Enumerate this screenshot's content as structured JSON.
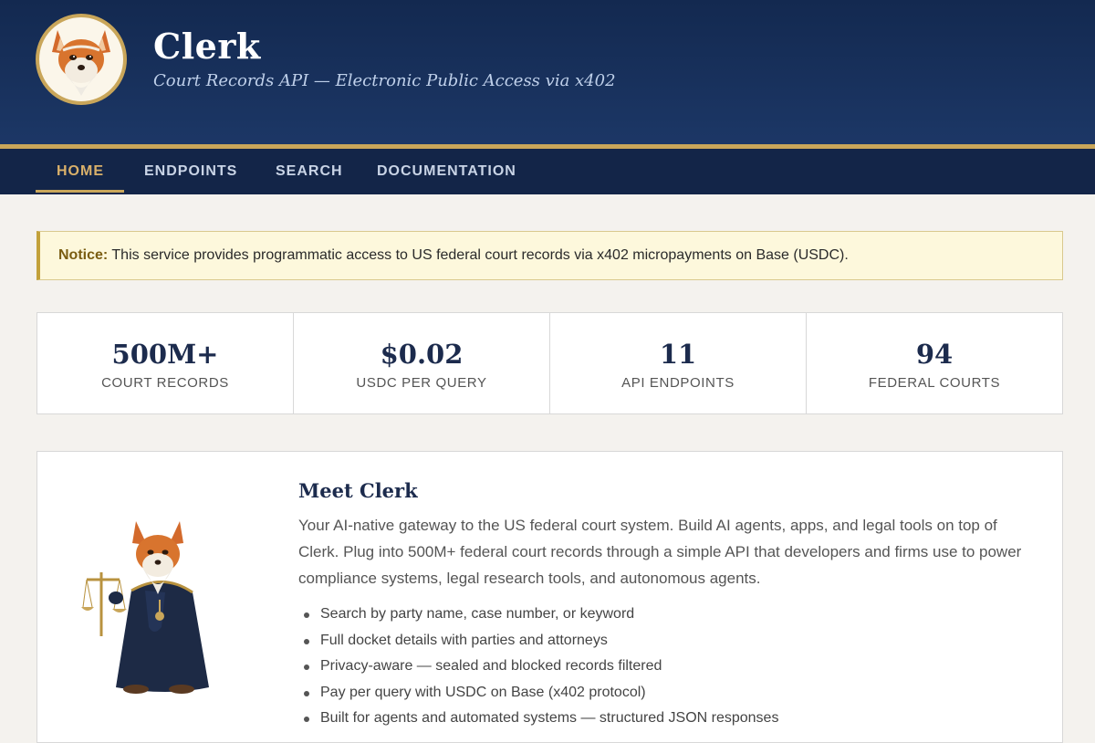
{
  "header": {
    "title": "Clerk",
    "subtitle": "Court Records API — Electronic Public Access via x402",
    "logo_icon": "fox-mascot-icon"
  },
  "nav": {
    "items": [
      {
        "label": "HOME",
        "active": true
      },
      {
        "label": "ENDPOINTS",
        "active": false
      },
      {
        "label": "SEARCH",
        "active": false
      },
      {
        "label": "DOCUMENTATION",
        "active": false
      }
    ]
  },
  "notice": {
    "label": "Notice:",
    "text": "This service provides programmatic access to US federal court records via x402 micropayments on Base (USDC)."
  },
  "stats": [
    {
      "value": "500M+",
      "label": "COURT RECORDS"
    },
    {
      "value": "$0.02",
      "label": "USDC PER QUERY"
    },
    {
      "value": "11",
      "label": "API ENDPOINTS"
    },
    {
      "value": "94",
      "label": "FEDERAL COURTS"
    }
  ],
  "about": {
    "title": "Meet Clerk",
    "description": "Your AI-native gateway to the US federal court system. Build AI agents, apps, and legal tools on top of Clerk. Plug into 500M+ federal court records through a simple API that developers and firms use to power compliance systems, legal research tools, and autonomous agents.",
    "features": [
      "Search by party name, case number, or keyword",
      "Full docket details with parties and attorneys",
      "Privacy-aware — sealed and blocked records filtered",
      "Pay per query with USDC on Base (x402 protocol)",
      "Built for agents and automated systems — structured JSON responses"
    ],
    "mascot_icon": "fox-judge-mascot-icon"
  },
  "colors": {
    "header_bg": "#1c3766",
    "nav_bg": "#132548",
    "gold_accent": "#c9a65a",
    "heading_navy": "#1c2b4d",
    "notice_bg": "#fdf8dc"
  }
}
